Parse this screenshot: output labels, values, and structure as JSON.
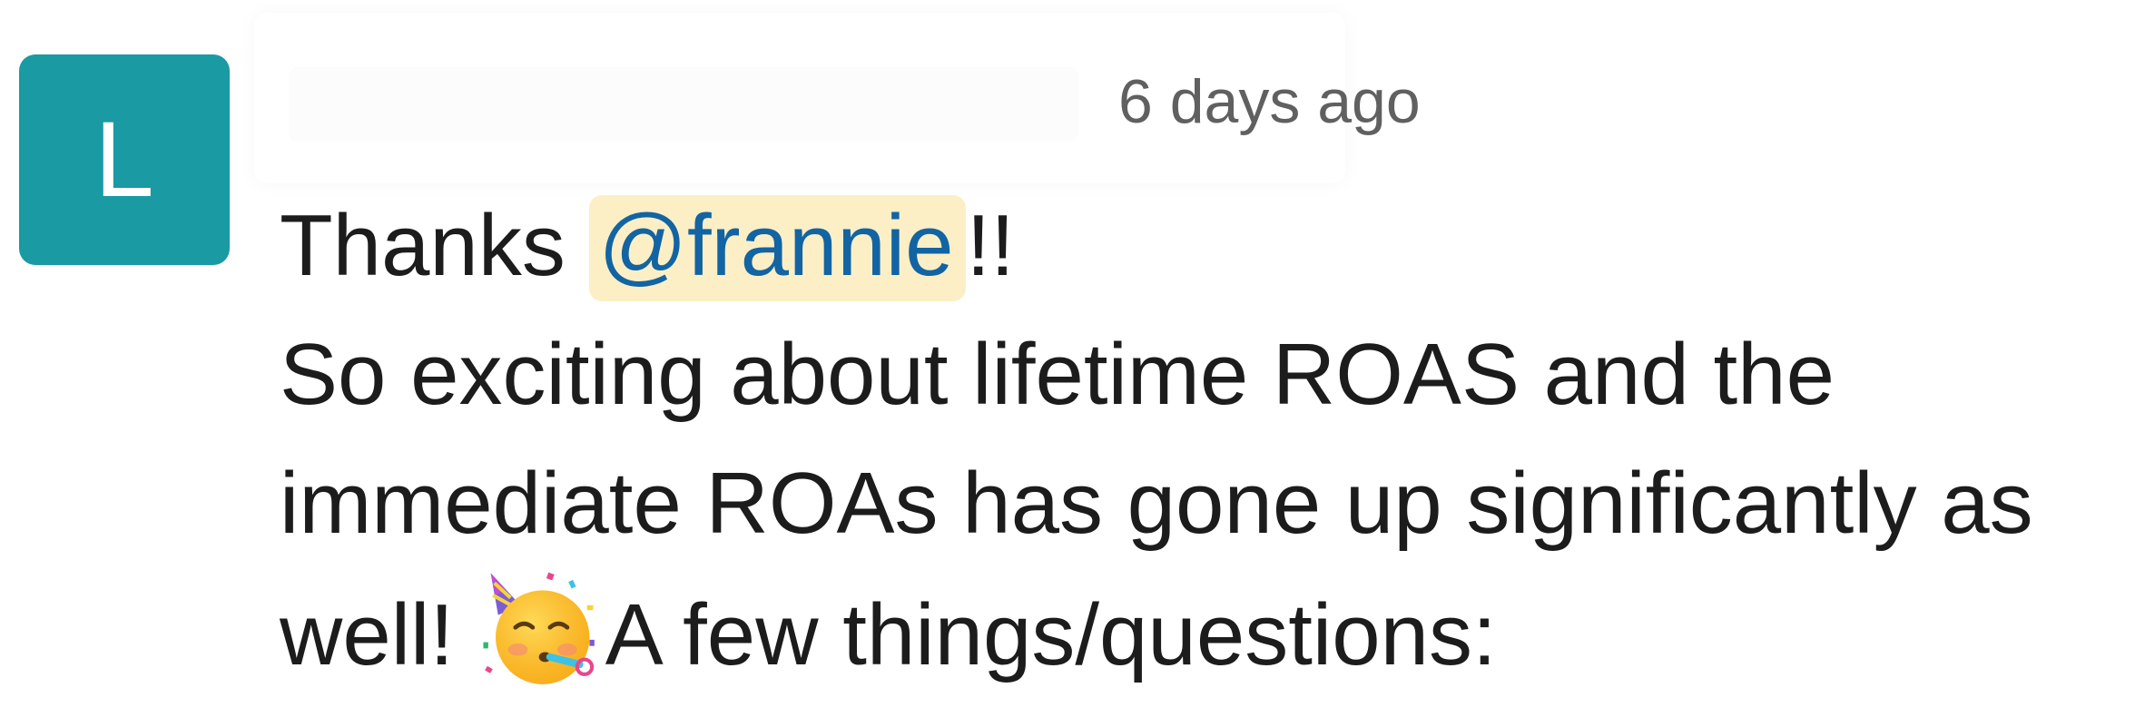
{
  "message": {
    "avatar_initial": "L",
    "avatar_color": "#1a9aa3",
    "timestamp": "6 days ago",
    "greeting_prefix": "Thanks ",
    "mention": "@frannie",
    "greeting_suffix": "!!",
    "line_2": "So exciting about lifetime ROAS and the",
    "line_3": "immediate ROAs has gone up significantly as",
    "line_4_prefix": "well! ",
    "line_4_suffix": "A few things/questions:",
    "emoji": "partying-face",
    "mention_color": "#1264a3",
    "mention_highlight": "#fcefc6"
  }
}
